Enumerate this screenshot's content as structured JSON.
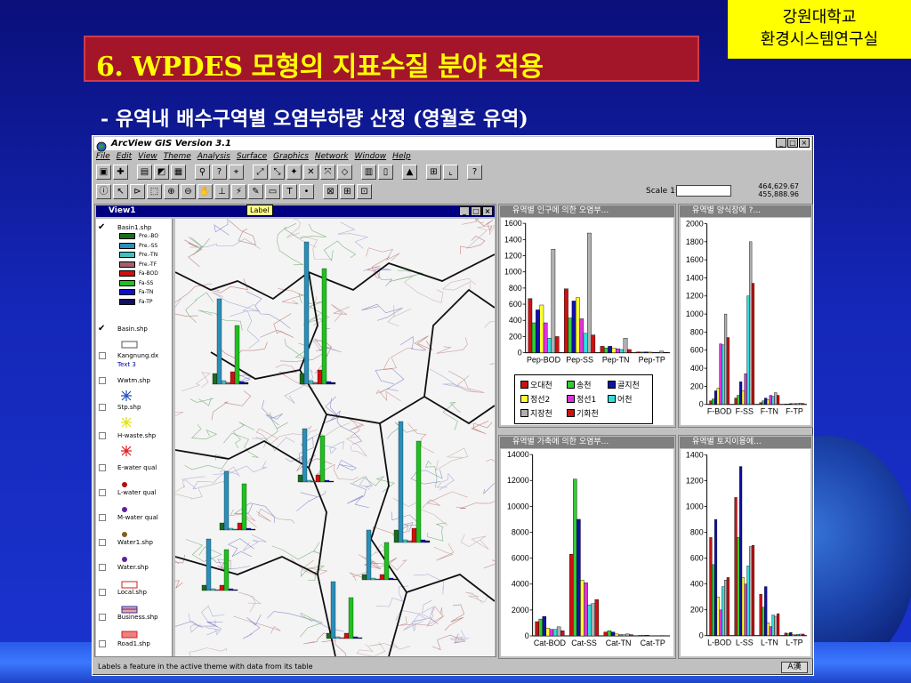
{
  "slide": {
    "title": "6. WPDES 모형의 지표수질 분야 적용",
    "logo_line1": "강원대학교",
    "logo_line2": "환경시스템연구실",
    "subtitle": "- 유역내 배수구역별 오염부하량 산정 (영월호 유역)"
  },
  "app": {
    "title": "ArcView GIS Version 3.1",
    "menu": [
      "File",
      "Edit",
      "View",
      "Theme",
      "Analysis",
      "Surface",
      "Graphics",
      "Network",
      "Window",
      "Help"
    ],
    "scale_label": "Scale 1:",
    "coord_x": "464,629.67",
    "coord_y": "455,888.96",
    "status_text": "Labels a feature in the active theme with data from its table",
    "ime_label": "A漢"
  },
  "view": {
    "title": "View1",
    "tooltip": "Label",
    "toc": [
      {
        "name": "Basin1.shp",
        "checked": true
      },
      {
        "name": "Basin.shp",
        "checked": true
      },
      {
        "name": "Kangnung.dx",
        "checked": false,
        "sub": "Text 3"
      },
      {
        "name": "Wwtm.shp",
        "checked": false
      },
      {
        "name": "Stp.shp",
        "checked": false
      },
      {
        "name": "H-waste.shp",
        "checked": false
      },
      {
        "name": "E-water qual",
        "checked": false
      },
      {
        "name": "L-water qual",
        "checked": false
      },
      {
        "name": "M-water qual",
        "checked": false
      },
      {
        "name": "Water1.shp",
        "checked": false
      },
      {
        "name": "Water.shp",
        "checked": false
      },
      {
        "name": "Local.shp",
        "checked": false
      },
      {
        "name": "Business.shp",
        "checked": false
      },
      {
        "name": "Road1.shp",
        "checked": false
      }
    ],
    "basin_legend": [
      {
        "label": "Pre.-BO",
        "color": "#1c6b1c"
      },
      {
        "label": "Pre.-SS",
        "color": "#2b8fb8"
      },
      {
        "label": "Pre.-TN",
        "color": "#40c0c0"
      },
      {
        "label": "Pre.-TF",
        "color": "#a06070"
      },
      {
        "label": "Fa-BOD",
        "color": "#d01010"
      },
      {
        "label": "Fa-SS",
        "color": "#20c020"
      },
      {
        "label": "Fa-TN",
        "color": "#1010c0"
      },
      {
        "label": "Fa-TP",
        "color": "#101060"
      }
    ]
  },
  "legend": [
    {
      "label": "오대천",
      "color": "#cc1111"
    },
    {
      "label": "송천",
      "color": "#33cc33"
    },
    {
      "label": "골지천",
      "color": "#1111aa"
    },
    {
      "label": "정선2",
      "color": "#ffff33"
    },
    {
      "label": "정선1",
      "color": "#dd33dd"
    },
    {
      "label": "어천",
      "color": "#33dddd"
    },
    {
      "label": "지장천",
      "color": "#b0b0b0"
    },
    {
      "label": "기화천",
      "color": "#cc1111"
    }
  ],
  "chart_data": [
    {
      "window_title": "유역별 인구에 의한 오염부...",
      "type": "bar",
      "categories": [
        "Pep-BOD",
        "Pep-SS",
        "Pep-TN",
        "Pep-TP"
      ],
      "ylim": [
        0,
        1600
      ],
      "yticks": [
        0,
        200,
        400,
        600,
        800,
        1000,
        1200,
        1400,
        1600
      ],
      "colors": [
        "#cc1111",
        "#33cc33",
        "#1111aa",
        "#ffff33",
        "#dd33dd",
        "#33dddd",
        "#b0b0b0",
        "#cc1111"
      ],
      "series_values": [
        [
          670,
          370,
          530,
          590,
          370,
          180,
          1280,
          200
        ],
        [
          790,
          430,
          640,
          680,
          420,
          240,
          1480,
          220
        ],
        [
          80,
          60,
          80,
          60,
          50,
          40,
          180,
          40
        ],
        [
          10,
          8,
          10,
          8,
          6,
          5,
          20,
          5
        ]
      ]
    },
    {
      "window_title": "유역별 양식장에 ?...",
      "type": "bar",
      "categories": [
        "F-BOD",
        "F-SS",
        "F-TN",
        "F-TP"
      ],
      "ylim": [
        0,
        2000
      ],
      "yticks": [
        0,
        200,
        400,
        600,
        800,
        1000,
        1200,
        1400,
        1600,
        1800,
        2000
      ],
      "colors": [
        "#cc1111",
        "#33cc33",
        "#1111aa",
        "#ffff33",
        "#dd33dd",
        "#33dddd",
        "#b0b0b0",
        "#cc1111"
      ],
      "series_values": [
        [
          40,
          60,
          150,
          180,
          670,
          660,
          1000,
          740
        ],
        [
          70,
          100,
          250,
          150,
          340,
          1200,
          1800,
          1340
        ],
        [
          20,
          40,
          70,
          50,
          100,
          90,
          130,
          100
        ],
        [
          5,
          5,
          10,
          8,
          10,
          10,
          15,
          10
        ]
      ]
    },
    {
      "window_title": "유역별 가축에 의한 오염부...",
      "type": "bar",
      "categories": [
        "Cat-BOD",
        "Cat-SS",
        "Cat-TN",
        "Cat-TP"
      ],
      "ylim": [
        0,
        14000
      ],
      "yticks": [
        0,
        2000,
        4000,
        6000,
        8000,
        10000,
        12000,
        14000
      ],
      "colors": [
        "#cc1111",
        "#33cc33",
        "#1111aa",
        "#ffff33",
        "#dd33dd",
        "#33dddd",
        "#b0b0b0",
        "#cc1111"
      ],
      "series_values": [
        [
          1100,
          1300,
          1500,
          600,
          500,
          500,
          700,
          400
        ],
        [
          6300,
          12100,
          9000,
          4300,
          4100,
          2400,
          2500,
          2800
        ],
        [
          300,
          400,
          300,
          150,
          100,
          100,
          150,
          100
        ],
        [
          40,
          60,
          50,
          20,
          20,
          20,
          30,
          20
        ]
      ]
    },
    {
      "window_title": "유역별 토지이용에...",
      "type": "bar",
      "categories": [
        "L-BOD",
        "L-SS",
        "L-TN",
        "L-TP"
      ],
      "ylim": [
        0,
        1400
      ],
      "yticks": [
        0,
        200,
        400,
        600,
        800,
        1000,
        1200,
        1400
      ],
      "colors": [
        "#cc1111",
        "#33cc33",
        "#1111aa",
        "#ffff33",
        "#dd33dd",
        "#33dddd",
        "#b0b0b0",
        "#cc1111"
      ],
      "series_values": [
        [
          760,
          550,
          900,
          300,
          200,
          380,
          430,
          450
        ],
        [
          1070,
          760,
          1310,
          450,
          400,
          540,
          690,
          700
        ],
        [
          320,
          220,
          380,
          100,
          70,
          160,
          150,
          170
        ],
        [
          20,
          15,
          25,
          8,
          6,
          10,
          12,
          12
        ]
      ]
    }
  ]
}
